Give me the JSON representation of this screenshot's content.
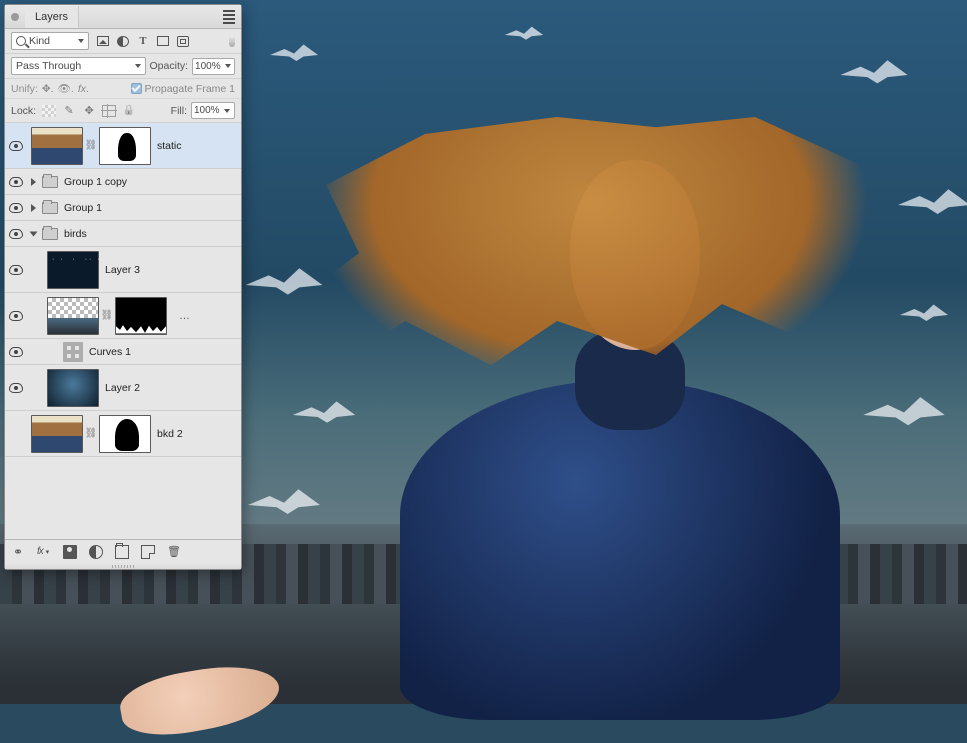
{
  "panel": {
    "tab_label": "Layers",
    "filter_kind": "Kind",
    "blend_mode": "Pass Through",
    "opacity_label": "Opacity:",
    "opacity_value": "100%",
    "unify_label": "Unify:",
    "propagate_label": "Propagate Frame 1",
    "propagate_checked": true,
    "lock_label": "Lock:",
    "fill_label": "Fill:",
    "fill_value": "100%"
  },
  "layers": [
    {
      "name": "static",
      "visible": true,
      "type": "image-masked",
      "indent": 0,
      "tall": true,
      "selected": true
    },
    {
      "name": "Group 1 copy",
      "visible": true,
      "type": "group-closed",
      "indent": 0
    },
    {
      "name": "Group 1",
      "visible": true,
      "type": "group-closed",
      "indent": 0
    },
    {
      "name": "birds",
      "visible": true,
      "type": "group-open",
      "indent": 0
    },
    {
      "name": "Layer 3",
      "visible": true,
      "type": "image",
      "thumb": "birds3",
      "indent": 1,
      "tall": true
    },
    {
      "name": "",
      "visible": true,
      "type": "image-masked-city",
      "indent": 1,
      "tall": true,
      "dots": true
    },
    {
      "name": "Curves 1",
      "visible": true,
      "type": "adjustment",
      "indent": 1
    },
    {
      "name": "Layer 2",
      "visible": true,
      "type": "image",
      "thumb": "sky",
      "indent": 1,
      "tall": true
    },
    {
      "name": "bkd 2",
      "visible": false,
      "type": "image-masked-inv",
      "indent": 0,
      "tall": true
    }
  ]
}
